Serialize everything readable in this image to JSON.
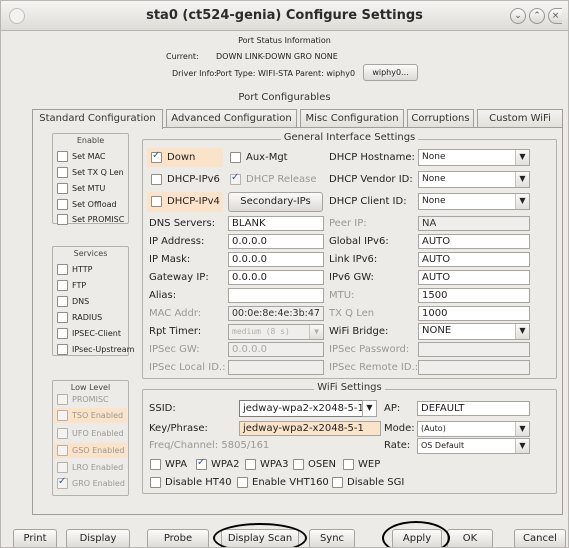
{
  "window": {
    "title": "sta0  (ct524-genia) Configure Settings"
  },
  "status": {
    "heading": "Port Status Information",
    "current_label": "Current:",
    "current_value": "DOWN LINK-DOWN GRO  NONE",
    "driver_label": "Driver Info:",
    "driver_value": "Port Type: WIFI-STA   Parent: wiphy0",
    "driver_button": "wiphy0..."
  },
  "port_configurables": "Port Configurables",
  "tabs": [
    "Standard Configuration",
    "Advanced Configuration",
    "Misc Configuration",
    "Corruptions",
    "Custom WiFi"
  ],
  "enable": {
    "title": "Enable",
    "items": [
      {
        "label": "Set MAC",
        "checked": false
      },
      {
        "label": "Set TX Q Len",
        "checked": false
      },
      {
        "label": "Set MTU",
        "checked": false
      },
      {
        "label": "Set Offload",
        "checked": false
      },
      {
        "label": "Set PROMISC",
        "checked": false
      }
    ]
  },
  "services": {
    "title": "Services",
    "items": [
      {
        "label": "HTTP",
        "checked": false
      },
      {
        "label": "FTP",
        "checked": false
      },
      {
        "label": "DNS",
        "checked": false
      },
      {
        "label": "RADIUS",
        "checked": false
      },
      {
        "label": "IPSEC-Client",
        "checked": false
      },
      {
        "label": "IPsec-Upstream",
        "checked": false
      }
    ]
  },
  "lowlevel": {
    "title": "Low Level",
    "items": [
      {
        "label": "PROMISC",
        "checked": false,
        "highlight": false
      },
      {
        "label": "TSO Enabled",
        "checked": false,
        "highlight": true
      },
      {
        "label": "UFO Enabled",
        "checked": false,
        "highlight": false
      },
      {
        "label": "GSO Enabled",
        "checked": false,
        "highlight": true
      },
      {
        "label": "LRO Enabled",
        "checked": false,
        "highlight": false
      },
      {
        "label": "GRO Enabled",
        "checked": true,
        "highlight": false
      }
    ]
  },
  "general": {
    "title": "General Interface Settings",
    "down": "Down",
    "aux_mgt": "Aux-Mgt",
    "dhcp_ipv6": "DHCP-IPv6",
    "dhcp_release": "DHCP Release",
    "dhcp_ipv4": "DHCP-IPv4",
    "secondary_ips": "Secondary-IPs",
    "dhcp_hostname_label": "DHCP Hostname:",
    "dhcp_hostname_value": "None",
    "dhcp_vendor_label": "DHCP Vendor ID:",
    "dhcp_vendor_value": "None",
    "dhcp_client_label": "DHCP Client ID:",
    "dhcp_client_value": "None",
    "dns_servers_label": "DNS Servers:",
    "dns_servers_value": "BLANK",
    "peer_ip_label": "Peer IP:",
    "peer_ip_value": "NA",
    "ip_address_label": "IP Address:",
    "ip_address_value": "0.0.0.0",
    "global_ipv6_label": "Global IPv6:",
    "global_ipv6_value": "AUTO",
    "ip_mask_label": "IP Mask:",
    "ip_mask_value": "0.0.0.0",
    "link_ipv6_label": "Link IPv6:",
    "link_ipv6_value": "AUTO",
    "gateway_ip_label": "Gateway IP:",
    "gateway_ip_value": "0.0.0.0",
    "ipv6_gw_label": "IPv6 GW:",
    "ipv6_gw_value": "AUTO",
    "alias_label": "Alias:",
    "alias_value": "",
    "mtu_label": "MTU:",
    "mtu_value": "1500",
    "mac_addr_label": "MAC Addr:",
    "mac_addr_value": "00:0e:8e:4e:3b:47",
    "tx_q_len_label": "TX Q Len",
    "tx_q_len_value": "1000",
    "rpt_timer_label": "Rpt Timer:",
    "rpt_timer_value": "medium  (8 s)",
    "wifi_bridge_label": "WiFi Bridge:",
    "wifi_bridge_value": "NONE",
    "ipsec_gw_label": "IPSec GW:",
    "ipsec_gw_value": "0.0.0.0",
    "ipsec_password_label": "IPSec Password:",
    "ipsec_local_label": "IPSec Local ID.:",
    "ipsec_remote_label": "IPSec Remote ID.:"
  },
  "wifi": {
    "title": "WiFi Settings",
    "ssid_label": "SSID:",
    "ssid_value": "jedway-wpa2-x2048-5-1",
    "ap_label": "AP:",
    "ap_value": "DEFAULT",
    "key_label": "Key/Phrase:",
    "key_value": "jedway-wpa2-x2048-5-1",
    "mode_label": "Mode:",
    "mode_value": "(Auto)",
    "freq_label": "Freq/Channel: 5805/161",
    "rate_label": "Rate:",
    "rate_value": "OS Default",
    "wpa": "WPA",
    "wpa2": "WPA2",
    "wpa3": "WPA3",
    "osen": "OSEN",
    "wep": "WEP",
    "disable_ht40": "Disable HT40",
    "enable_vht160": "Enable VHT160",
    "disable_sgi": "Disable SGI"
  },
  "footer": {
    "print": "Print",
    "display": "Display",
    "probe": "Probe",
    "display_scan": "Display Scan",
    "sync": "Sync",
    "apply": "Apply",
    "ok": "OK",
    "cancel": "Cancel"
  },
  "colors": {
    "highlight": "#fbe3c9",
    "background": "#ecebe8"
  }
}
